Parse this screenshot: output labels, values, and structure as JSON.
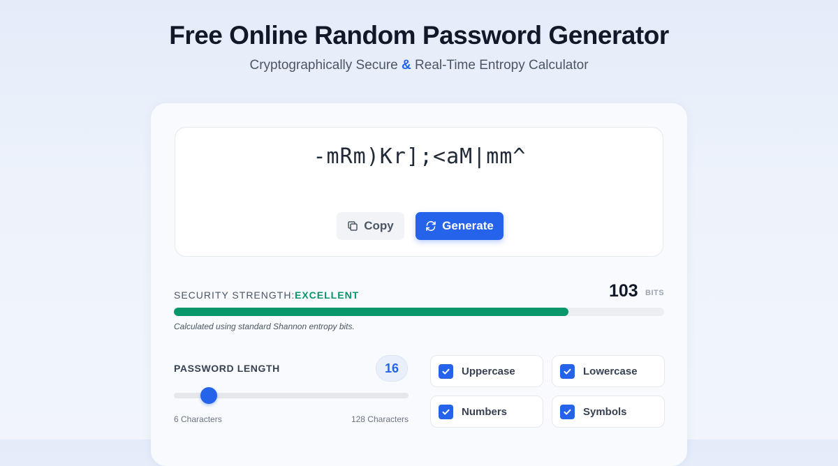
{
  "header": {
    "title": "Free Online Random Password Generator",
    "subtitle_part1": "Cryptographically Secure",
    "subtitle_amp": "&",
    "subtitle_part2": "Real-Time Entropy Calculator"
  },
  "password": {
    "value": "-mRm)Kr];<aM|mm^"
  },
  "buttons": {
    "copy_label": "Copy",
    "generate_label": "Generate"
  },
  "strength": {
    "label": "SECURITY STRENGTH:",
    "value": "EXCELLENT",
    "bits": "103",
    "bits_unit": "BITS",
    "fill_fraction": 0.805,
    "note": "Calculated using standard Shannon entropy bits.",
    "color": "#059669"
  },
  "length": {
    "label": "PASSWORD LENGTH",
    "value": "16",
    "min_label": "6 Characters",
    "max_label": "128 Characters",
    "min": 6,
    "max": 128,
    "current": 16
  },
  "options": [
    {
      "label": "Uppercase",
      "checked": true
    },
    {
      "label": "Lowercase",
      "checked": true
    },
    {
      "label": "Numbers",
      "checked": true
    },
    {
      "label": "Symbols",
      "checked": true
    }
  ],
  "colors": {
    "accent": "#2563eb",
    "success": "#059669"
  },
  "icons": {
    "copy": "copy-icon",
    "generate": "refresh-icon",
    "checkbox": "checkmark-icon"
  }
}
